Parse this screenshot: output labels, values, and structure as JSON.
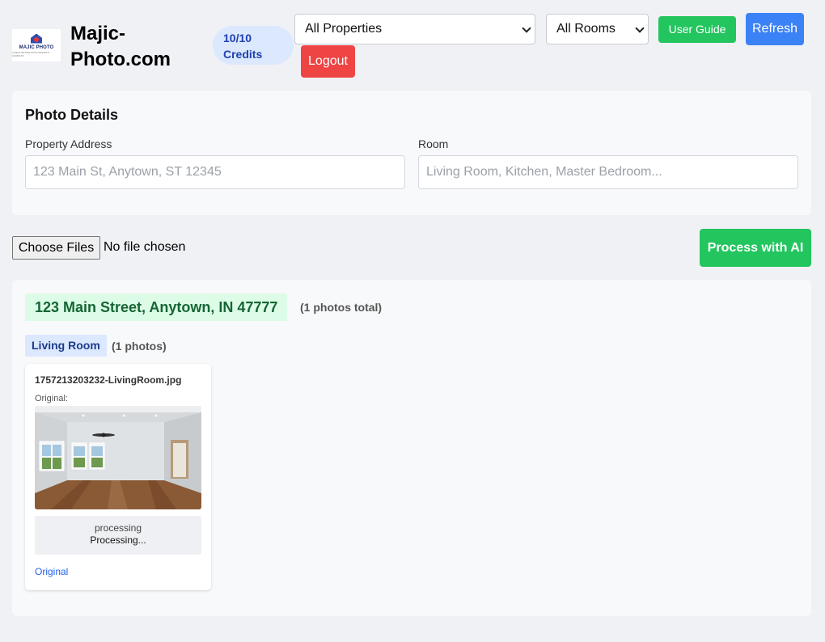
{
  "header": {
    "logo": {
      "text": "MAJIC PHOTO",
      "sub": "A REAL ESTATE PHOTOGRAPHY COMPANY"
    },
    "brand": "Majic-Photo.com",
    "credits": "10/10 Credits",
    "property_filter": "All Properties",
    "room_filter": "All Rooms",
    "user_guide_label": "User Guide",
    "refresh_label": "Refresh",
    "logout_label": "Logout"
  },
  "details": {
    "title": "Photo Details",
    "address_label": "Property Address",
    "address_placeholder": "123 Main St, Anytown, ST 12345",
    "room_label": "Room",
    "room_placeholder": "Living Room, Kitchen, Master Bedroom..."
  },
  "upload": {
    "choose_label": "Choose Files",
    "status": "No file chosen",
    "process_label": "Process with AI"
  },
  "results": {
    "address": "123 Main Street, Anytown, IN 47777",
    "total": "(1 photos total)",
    "room": "Living Room",
    "room_count": "(1 photos)",
    "card": {
      "filename": "1757213203232-LivingRoom.jpg",
      "original_label": "Original:",
      "status_state": "processing",
      "status_message": "Processing...",
      "link": "Original"
    }
  },
  "colors": {
    "green": "#22c55e",
    "blue": "#3b82f6",
    "red": "#ef4444",
    "address_bg": "#dcfce7",
    "room_bg": "#dbe8fe"
  }
}
